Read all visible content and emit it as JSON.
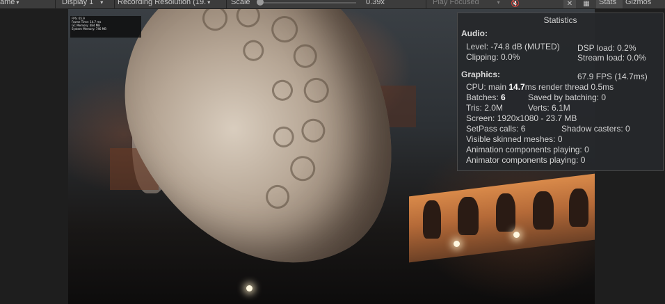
{
  "toolbar": {
    "game_tab": "ame",
    "display": "Display 1",
    "resolution": "Recording Resolution (19.",
    "scale_label": "Scale",
    "scale_value": "0.39x",
    "play_focused": "Play Focused",
    "stats": "Stats",
    "gizmos": "Gizmos"
  },
  "mini_stats": {
    "fps": "FPS: 65.9",
    "frame_time": "Frame Time: 14.7 ms",
    "gc_memory": "GC Memory: 484 MB",
    "system_memory": "System Memory: 746 MB"
  },
  "statistics": {
    "title": "Statistics",
    "audio_header": "Audio:",
    "level": "Level: -74.8 dB (MUTED)",
    "dsp_load": "DSP load: 0.2%",
    "clipping": "Clipping: 0.0%",
    "stream_load": "Stream load: 0.0%",
    "graphics_header": "Graphics:",
    "fps": "67.9 FPS (14.7ms)",
    "cpu_prefix": "CPU: main ",
    "cpu_main": "14.7",
    "cpu_suffix": "ms  render thread 0.5ms",
    "batches_prefix": "Batches: ",
    "batches": "6",
    "saved_by_batching": "Saved by batching: 0",
    "tris": "Tris: 2.0M",
    "verts": "Verts: 6.1M",
    "screen": "Screen: 1920x1080 - 23.7 MB",
    "setpass": "SetPass calls: 6",
    "shadow_casters": "Shadow casters: 0",
    "skinned_meshes": "Visible skinned meshes: 0",
    "animation_components": "Animation components playing: 0",
    "animator_components": "Animator components playing: 0"
  },
  "icons": {
    "dropdown": "chevron-down-icon",
    "mute": "mute-audio-icon",
    "stats_toggle": "stats-icon",
    "grid": "grid-icon"
  }
}
